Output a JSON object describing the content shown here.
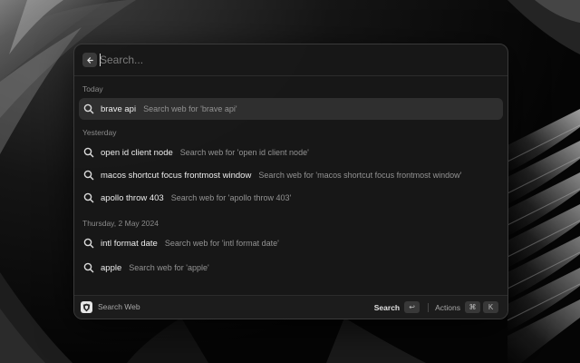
{
  "search": {
    "placeholder": "Search..."
  },
  "sections": [
    {
      "title": "Today",
      "items": [
        {
          "title": "brave api",
          "subtitle": "Search web for 'brave api'",
          "selected": true
        }
      ]
    },
    {
      "title": "Yesterday",
      "items": [
        {
          "title": "open id client node",
          "subtitle": "Search web for 'open id client node'"
        },
        {
          "title": "macos shortcut focus frontmost window",
          "subtitle": "Search web for 'macos shortcut focus frontmost window'"
        },
        {
          "title": "apollo throw 403",
          "subtitle": "Search web for 'apollo throw 403'"
        }
      ]
    },
    {
      "title": "Thursday, 2 May 2024",
      "items": [
        {
          "title": "intl format date",
          "subtitle": "Search web for 'intl format date'"
        },
        {
          "title": "apple",
          "subtitle": "Search web for 'apple'"
        }
      ]
    }
  ],
  "footer": {
    "extension_name": "Search Web",
    "primary_action": "Search",
    "primary_key": "↩",
    "actions_label": "Actions",
    "actions_keys": [
      "⌘",
      "K"
    ]
  },
  "icons": {
    "back": "arrow-left-icon",
    "item": "search-icon",
    "extension": "brave-shield-icon"
  },
  "colors": {
    "panel_bg": "#181818",
    "selected_bg": "#2f2f2f",
    "text_primary": "#ededed",
    "text_secondary": "#939393"
  }
}
